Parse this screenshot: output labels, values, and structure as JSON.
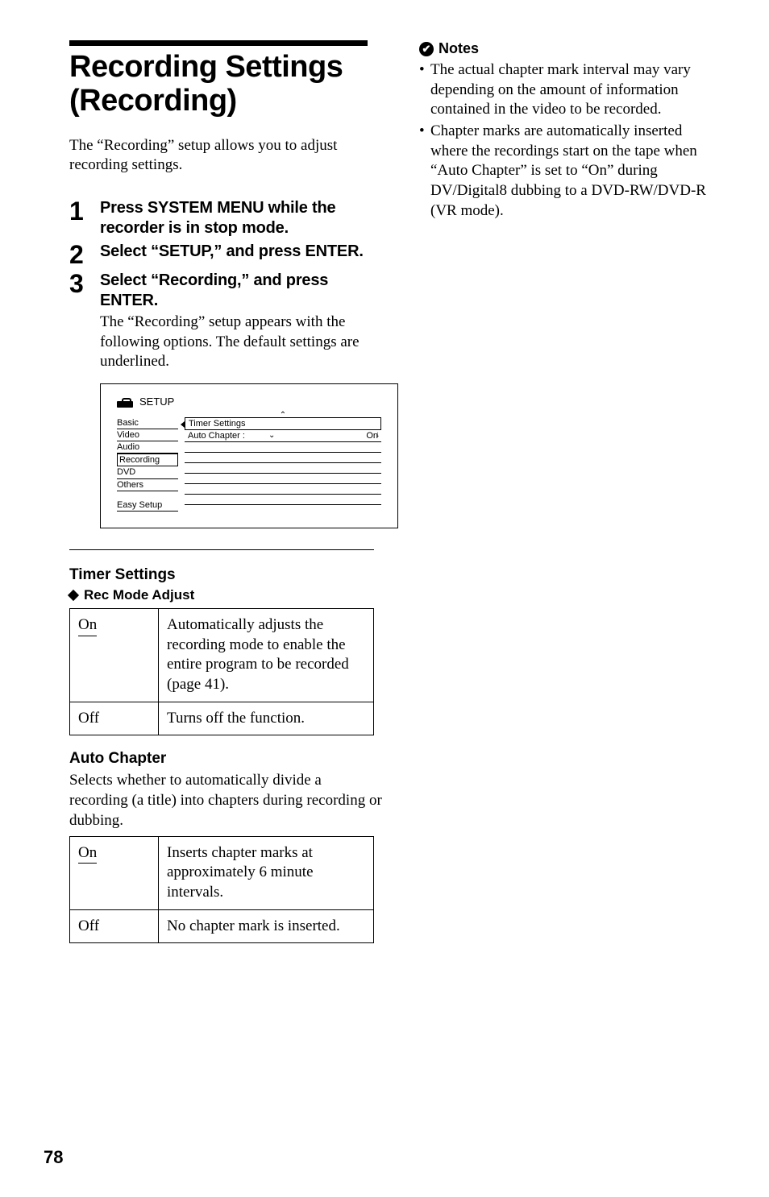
{
  "title": "Recording Settings (Recording)",
  "intro": "The “Recording” setup allows you to adjust recording settings.",
  "steps": [
    {
      "num": "1",
      "title": "Press SYSTEM MENU while the recorder is in stop mode."
    },
    {
      "num": "2",
      "title": "Select “SETUP,” and press ENTER."
    },
    {
      "num": "3",
      "title": "Select “Recording,” and press ENTER.",
      "desc": "The “Recording” setup appears with the following options. The default settings are underlined."
    }
  ],
  "setup_screen": {
    "header": "SETUP",
    "left_items_top": [
      "Basic",
      "Video",
      "Audio",
      "Recording",
      "DVD",
      "Others"
    ],
    "left_items_bottom": [
      "Easy Setup"
    ],
    "selected_left": "Recording",
    "right_first": "Timer Settings",
    "right_rows": [
      {
        "label": "Auto Chapter :",
        "value": "On"
      }
    ]
  },
  "timer_heading": "Timer Settings",
  "rec_mode_heading": "Rec Mode Adjust",
  "rec_mode_table": [
    {
      "key": "On",
      "underline": true,
      "desc": "Automatically adjusts the recording mode to enable the entire program to be recorded (page 41)."
    },
    {
      "key": "Off",
      "underline": false,
      "desc": "Turns off the function."
    }
  ],
  "auto_chapter_heading": "Auto Chapter",
  "auto_chapter_para": "Selects whether to automatically divide a recording (a title) into chapters during recording or dubbing.",
  "auto_chapter_table": [
    {
      "key": "On",
      "underline": true,
      "desc": "Inserts chapter marks at approximately 6 minute intervals."
    },
    {
      "key": "Off",
      "underline": false,
      "desc": "No chapter mark is inserted."
    }
  ],
  "notes_heading": "Notes",
  "notes": [
    "The actual chapter mark interval may vary depending on the amount of information contained in the video to be recorded.",
    "Chapter marks are automatically inserted where the recordings start on the tape when “Auto Chapter” is set to “On” during DV/Digital8 dubbing to a DVD-RW/DVD-R (VR mode)."
  ],
  "page_number": "78"
}
